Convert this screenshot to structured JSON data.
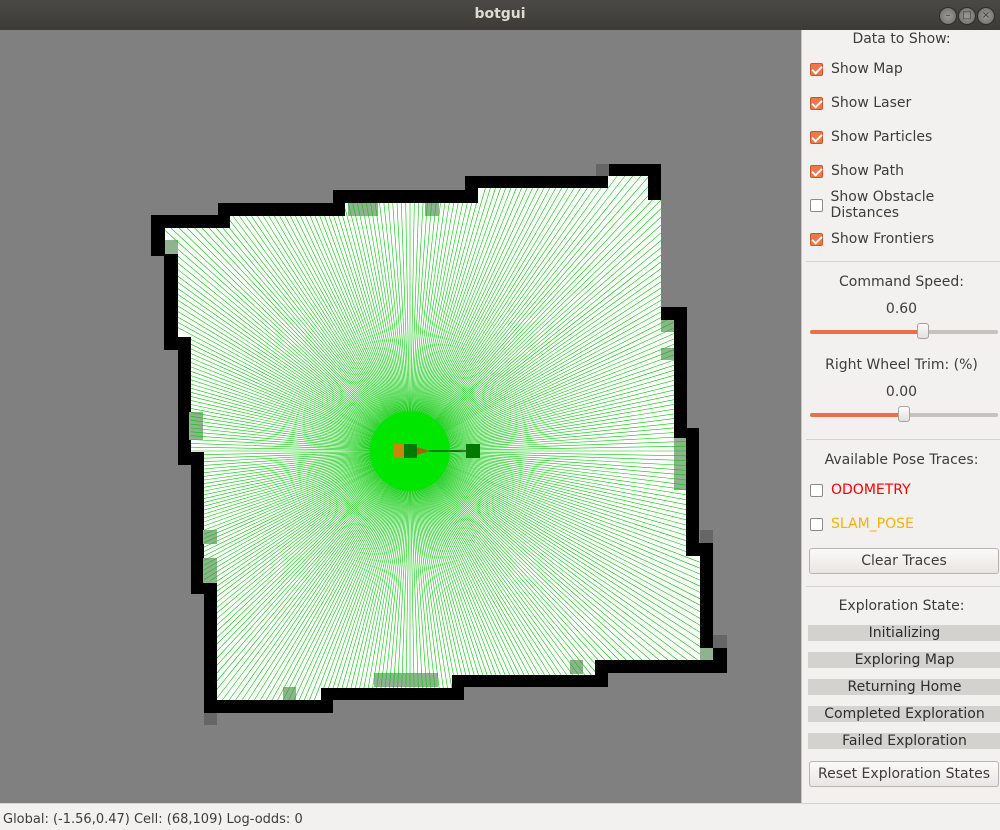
{
  "window": {
    "title": "botgui",
    "controls": [
      "minimize-icon",
      "maximize-icon",
      "close-icon"
    ]
  },
  "panel": {
    "data_header": "Data to Show:",
    "options": [
      {
        "label": "Show Map",
        "checked": true
      },
      {
        "label": "Show Laser",
        "checked": true
      },
      {
        "label": "Show Particles",
        "checked": true
      },
      {
        "label": "Show Path",
        "checked": true
      },
      {
        "label": "Show Obstacle Distances",
        "checked": false
      },
      {
        "label": "Show Frontiers",
        "checked": true
      }
    ],
    "speed": {
      "label": "Command Speed:",
      "value": "0.60",
      "fraction": 0.6
    },
    "trim": {
      "label": "Right Wheel Trim: (%)",
      "value": "0.00",
      "fraction": 0.5
    },
    "traces_header": "Available Pose Traces:",
    "traces": [
      {
        "label": "ODOMETRY",
        "checked": false,
        "color": "#ff0000"
      },
      {
        "label": "SLAM_POSE",
        "checked": false,
        "color": "#ffb000"
      }
    ],
    "clear_button": "Clear Traces",
    "exploration_header": "Exploration State:",
    "states": [
      "Initializing",
      "Exploring Map",
      "Returning Home",
      "Completed Exploration",
      "Failed Exploration"
    ],
    "reset_button": "Reset Exploration States"
  },
  "status": {
    "text": "Global: (-1.56,0.47) Cell: (68,109) Log-odds: 0"
  },
  "colors": {
    "map_background": "#808080",
    "free_space": "#ffffff",
    "wall": "#000000",
    "laser": "#00c800",
    "accent": "#f07746"
  }
}
